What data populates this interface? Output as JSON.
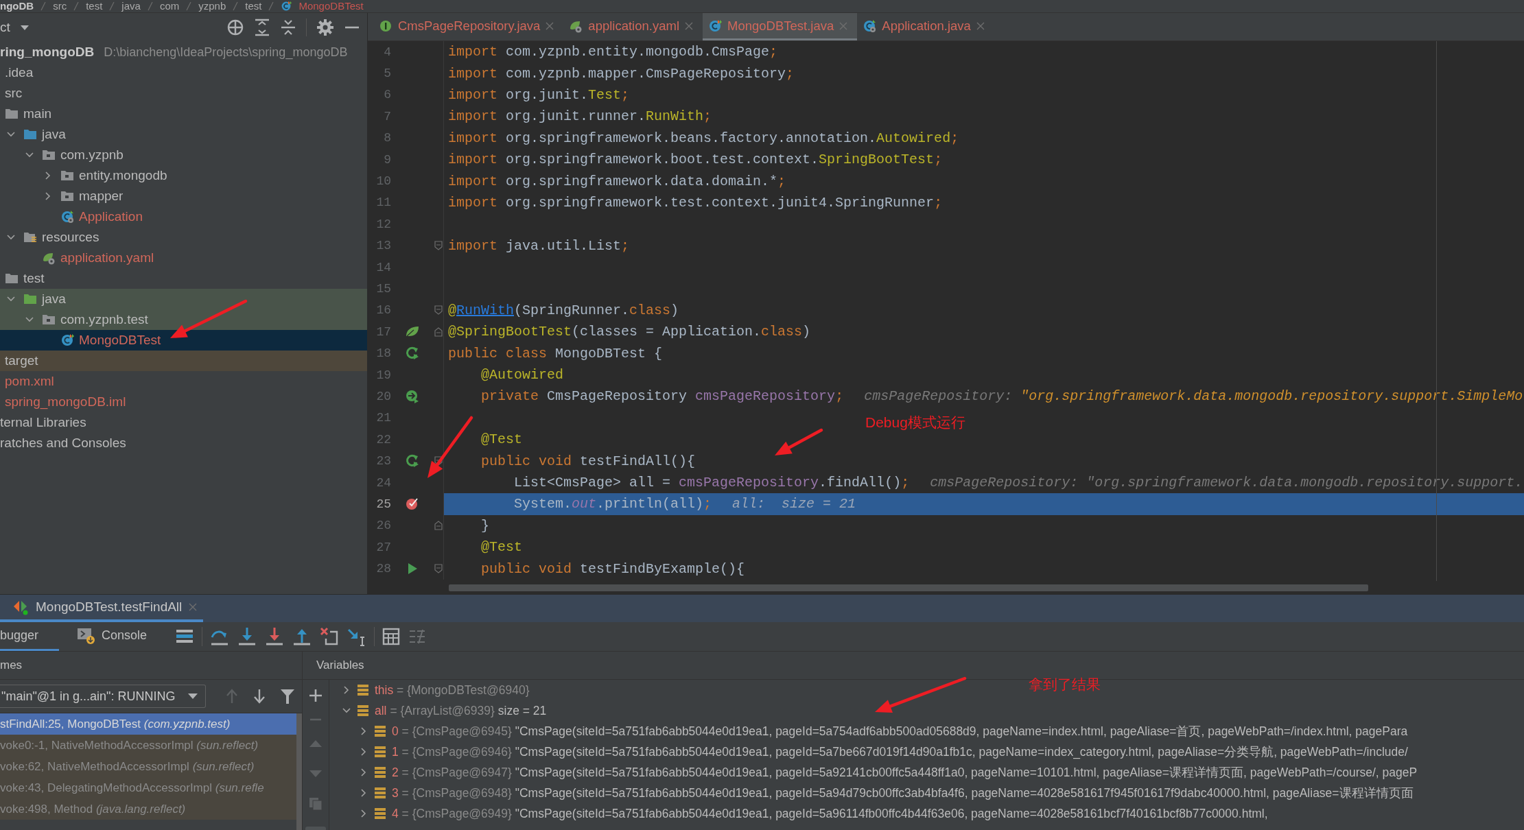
{
  "breadcrumb": [
    {
      "label": "ngoDB",
      "kind": "module"
    },
    {
      "label": "src"
    },
    {
      "label": "test"
    },
    {
      "label": "java"
    },
    {
      "label": "com"
    },
    {
      "label": "yzpnb"
    },
    {
      "label": "test"
    },
    {
      "label": "MongoDBTest",
      "kind": "class"
    }
  ],
  "project_panel": {
    "title": "ct",
    "tree": [
      {
        "label": "ring_mongoDB",
        "kind": "module",
        "path": "D:\\biancheng\\IdeaProjects\\spring_mongoDB",
        "untracked": false,
        "selected": false,
        "children": [
          {
            "label": ".idea",
            "untracked": false,
            "selected": false
          },
          {
            "label": "src",
            "untracked": false,
            "selected": false,
            "children": [
              {
                "label": "main",
                "kind": "folder",
                "untracked": false,
                "selected": false,
                "children": [
                  {
                    "label": "java",
                    "kind": "source_root",
                    "expanded": true,
                    "untracked": false,
                    "selected": false,
                    "children": [
                      {
                        "label": "com.yzpnb",
                        "kind": "package",
                        "expanded": true,
                        "untracked": false,
                        "selected": false,
                        "children": [
                          {
                            "label": "entity.mongodb",
                            "kind": "package",
                            "expanded": false,
                            "untracked": false,
                            "selected": false
                          },
                          {
                            "label": "mapper",
                            "kind": "package",
                            "expanded": false,
                            "untracked": false,
                            "selected": false
                          },
                          {
                            "label": "Application",
                            "kind": "boot_class",
                            "untracked": true,
                            "selected": false
                          }
                        ]
                      }
                    ]
                  },
                  {
                    "label": "resources",
                    "kind": "resources_root",
                    "expanded": true,
                    "untracked": false,
                    "selected": false,
                    "children": [
                      {
                        "label": "application.yaml",
                        "kind": "yaml",
                        "untracked": true,
                        "selected": false
                      }
                    ]
                  }
                ]
              },
              {
                "label": "test",
                "kind": "folder",
                "untracked": false,
                "selected": false,
                "children": [
                  {
                    "label": "java",
                    "kind": "test_root",
                    "expanded": true,
                    "test_scope": true,
                    "untracked": false,
                    "selected": false,
                    "children": [
                      {
                        "label": "com.yzpnb.test",
                        "kind": "package",
                        "expanded": true,
                        "test_scope": true,
                        "untracked": false,
                        "selected": false,
                        "children": [
                          {
                            "label": "MongoDBTest",
                            "kind": "test_class",
                            "untracked": true,
                            "selected": true
                          }
                        ]
                      }
                    ]
                  }
                ]
              }
            ]
          },
          {
            "label": "target",
            "excluded": true,
            "untracked": false,
            "selected": false
          },
          {
            "label": "pom.xml",
            "untracked": true,
            "selected": false
          },
          {
            "label": "spring_mongoDB.iml",
            "untracked": true,
            "selected": false
          }
        ]
      },
      {
        "label": "ternal Libraries",
        "untracked": false,
        "selected": false
      },
      {
        "label": "ratches and Consoles",
        "untracked": false,
        "selected": false
      }
    ]
  },
  "editor": {
    "tabs": [
      {
        "label": "CmsPageRepository.java",
        "kind": "interface",
        "selected": false
      },
      {
        "label": "application.yaml",
        "kind": "yaml",
        "selected": false
      },
      {
        "label": "MongoDBTest.java",
        "kind": "test_class",
        "selected": true
      },
      {
        "label": "Application.java",
        "kind": "boot_class",
        "selected": false
      }
    ],
    "lines": [
      {
        "number": "4",
        "current": false,
        "tokens": [
          {
            "text": "import",
            "kind": "keyword"
          },
          {
            "text": " com.yzpnb.entity.mongodb.CmsPage",
            "kind": "plain"
          },
          {
            "text": ";",
            "kind": "keyword"
          }
        ]
      },
      {
        "number": "5",
        "current": false,
        "tokens": [
          {
            "text": "import",
            "kind": "keyword"
          },
          {
            "text": " com.yzpnb.mapper.CmsPageRepository",
            "kind": "plain"
          },
          {
            "text": ";",
            "kind": "keyword"
          }
        ]
      },
      {
        "number": "6",
        "current": false,
        "tokens": [
          {
            "text": "import",
            "kind": "keyword"
          },
          {
            "text": " org.junit.",
            "kind": "plain"
          },
          {
            "text": "Test",
            "kind": "annotation"
          },
          {
            "text": ";",
            "kind": "keyword"
          }
        ]
      },
      {
        "number": "7",
        "current": false,
        "tokens": [
          {
            "text": "import",
            "kind": "keyword"
          },
          {
            "text": " org.junit.runner.",
            "kind": "plain"
          },
          {
            "text": "RunWith",
            "kind": "annotation"
          },
          {
            "text": ";",
            "kind": "keyword"
          }
        ]
      },
      {
        "number": "8",
        "current": false,
        "tokens": [
          {
            "text": "import",
            "kind": "keyword"
          },
          {
            "text": " org.springframework.beans.factory.annotation.",
            "kind": "plain"
          },
          {
            "text": "Autowired",
            "kind": "annotation"
          },
          {
            "text": ";",
            "kind": "keyword"
          }
        ]
      },
      {
        "number": "9",
        "current": false,
        "tokens": [
          {
            "text": "import",
            "kind": "keyword"
          },
          {
            "text": " org.springframework.boot.test.context.",
            "kind": "plain"
          },
          {
            "text": "SpringBootTest",
            "kind": "annotation"
          },
          {
            "text": ";",
            "kind": "keyword"
          }
        ]
      },
      {
        "number": "10",
        "current": false,
        "tokens": [
          {
            "text": "import",
            "kind": "keyword"
          },
          {
            "text": " org.springframework.data.domain.*",
            "kind": "plain"
          },
          {
            "text": ";",
            "kind": "keyword"
          }
        ]
      },
      {
        "number": "11",
        "current": false,
        "tokens": [
          {
            "text": "import",
            "kind": "keyword"
          },
          {
            "text": " org.springframework.test.context.junit4.SpringRunner",
            "kind": "plain"
          },
          {
            "text": ";",
            "kind": "keyword"
          }
        ]
      },
      {
        "number": "12",
        "current": false
      },
      {
        "number": "13",
        "current": false,
        "gutter": [
          {
            "kind": "fold_start"
          }
        ],
        "tokens": [
          {
            "text": "import",
            "kind": "keyword"
          },
          {
            "text": " java.util.List",
            "kind": "plain"
          },
          {
            "text": ";",
            "kind": "keyword"
          }
        ]
      },
      {
        "number": "14",
        "current": false
      },
      {
        "number": "15",
        "current": false
      },
      {
        "number": "16",
        "current": false,
        "gutter": [
          {
            "kind": "fold_start"
          }
        ],
        "tokens": [
          {
            "text": "@",
            "kind": "annotation"
          },
          {
            "text": "RunWith",
            "kind": "link"
          },
          {
            "text": "(SpringRunner.",
            "kind": "plain"
          },
          {
            "text": "class",
            "kind": "keyword"
          },
          {
            "text": ")",
            "kind": "plain"
          }
        ]
      },
      {
        "number": "17",
        "current": false,
        "gutter": [
          {
            "kind": "leaf"
          },
          {
            "kind": "fold_end"
          }
        ],
        "tokens": [
          {
            "text": "@SpringBootTest",
            "kind": "annotation"
          },
          {
            "text": "(classes = Application.",
            "kind": "plain"
          },
          {
            "text": "class",
            "kind": "keyword"
          },
          {
            "text": ")",
            "kind": "plain"
          }
        ]
      },
      {
        "number": "18",
        "current": false,
        "gutter": [
          {
            "kind": "rerun"
          }
        ],
        "tokens": [
          {
            "text": "public class",
            "kind": "keyword"
          },
          {
            "text": " MongoDBTest {",
            "kind": "plain"
          }
        ]
      },
      {
        "number": "19",
        "current": false,
        "tokens": [
          {
            "text": "    @Autowired",
            "kind": "annotation"
          }
        ]
      },
      {
        "number": "20",
        "current": false,
        "gutter": [
          {
            "kind": "bean"
          }
        ],
        "tokens": [
          {
            "text": "    private",
            "kind": "keyword"
          },
          {
            "text": " CmsPageRepository ",
            "kind": "plain"
          },
          {
            "text": "cmsPageRepository",
            "kind": "field"
          },
          {
            "text": ";",
            "kind": "keyword"
          }
        ],
        "hint": [
          {
            "text": "cmsPageRepository: ",
            "kind": "hint"
          },
          {
            "text": "\"org.springframework.data.mongodb.repository.support.SimpleMo",
            "kind": "hint_value"
          }
        ]
      },
      {
        "number": "21",
        "current": false
      },
      {
        "number": "22",
        "current": false,
        "tokens": [
          {
            "text": "    @Test",
            "kind": "annotation"
          }
        ]
      },
      {
        "number": "23",
        "current": false,
        "gutter": [
          {
            "kind": "rerun"
          },
          {
            "kind": "fold_start"
          }
        ],
        "tokens": [
          {
            "text": "    public void",
            "kind": "keyword"
          },
          {
            "text": " testFindAll(){",
            "kind": "plain"
          }
        ]
      },
      {
        "number": "24",
        "current": false,
        "tokens": [
          {
            "text": "        List<CmsPage> all = ",
            "kind": "plain"
          },
          {
            "text": "cmsPageRepository",
            "kind": "field"
          },
          {
            "text": ".findAll()",
            "kind": "plain"
          },
          {
            "text": ";",
            "kind": "keyword"
          }
        ],
        "hint": [
          {
            "text": "cmsPageRepository: \"org.springframework.data.mongodb.repository.support.",
            "kind": "hint"
          }
        ]
      },
      {
        "number": "25",
        "current": true,
        "gutter": [
          {
            "kind": "breakpoint"
          }
        ],
        "tokens": [
          {
            "text": "        System.",
            "kind": "plain"
          },
          {
            "text": "out",
            "kind": "static"
          },
          {
            "text": ".println(all)",
            "kind": "plain"
          },
          {
            "text": ";",
            "kind": "keyword"
          }
        ],
        "hint": [
          {
            "text": "all:  size = 21",
            "kind": "hint"
          }
        ]
      },
      {
        "number": "26",
        "current": false,
        "gutter": [
          {
            "kind": "fold_end"
          }
        ],
        "tokens": [
          {
            "text": "    }",
            "kind": "plain"
          }
        ]
      },
      {
        "number": "27",
        "current": false,
        "tokens": [
          {
            "text": "    @Test",
            "kind": "annotation"
          }
        ]
      },
      {
        "number": "28",
        "current": false,
        "gutter": [
          {
            "kind": "play"
          },
          {
            "kind": "fold_start"
          }
        ],
        "tokens": [
          {
            "text": "    public void",
            "kind": "keyword"
          },
          {
            "text": " testFindByExample(){",
            "kind": "plain"
          }
        ]
      }
    ]
  },
  "debug": {
    "session_tab": "MongoDBTest.testFindAll",
    "tabs": [
      {
        "label": "bugger",
        "kind": "debugger",
        "selected": true
      },
      {
        "label": "Console",
        "kind": "console",
        "selected": false
      }
    ],
    "frames_title": "mes",
    "thread": "\"main\"@1 in g...ain\": RUNNING",
    "frames": [
      {
        "label": "stFindAll:25, MongoDBTest *(com.yzpnb.test)*",
        "kind": "app",
        "selected": true
      },
      {
        "label": "voke0:-1, NativeMethodAccessorImpl *(sun.reflect)*",
        "kind": "library",
        "selected": false
      },
      {
        "label": "voke:62, NativeMethodAccessorImpl *(sun.reflect)*",
        "kind": "library",
        "selected": false
      },
      {
        "label": "voke:43, DelegatingMethodAccessorImpl *(sun.refle*",
        "kind": "library",
        "selected": false
      },
      {
        "label": "voke:498, Method *(java.lang.reflect)*",
        "kind": "library",
        "selected": false
      }
    ],
    "variables_title": "Variables",
    "variables": [
      {
        "name": "this",
        "type": "= {MongoDBTest@6940}",
        "expanded": false
      },
      {
        "name": "all",
        "type": "= {ArrayList@6939}",
        "value": "size = 21",
        "expanded": true,
        "children": [
          {
            "name": "0",
            "type": "= {CmsPage@6945}",
            "value": "\"CmsPage(siteId=5a751fab6abb5044e0d19ea1, pageId=5a754adf6abb500ad05688d9, pageName=index.html, pageAliase=首页, pageWebPath=/index.html, pagePara",
            "expanded": false
          },
          {
            "name": "1",
            "type": "= {CmsPage@6946}",
            "value": "\"CmsPage(siteId=5a751fab6abb5044e0d19ea1, pageId=5a7be667d019f14d90a1fb1c, pageName=index_category.html, pageAliase=分类导航, pageWebPath=/include/",
            "expanded": false
          },
          {
            "name": "2",
            "type": "= {CmsPage@6947}",
            "value": "\"CmsPage(siteId=5a751fab6abb5044e0d19ea1, pageId=5a92141cb00ffc5a448ff1a0, pageName=10101.html, pageAliase=课程详情页面, pageWebPath=/course/, pageP",
            "expanded": false
          },
          {
            "name": "3",
            "type": "= {CmsPage@6948}",
            "value": "\"CmsPage(siteId=5a751fab6abb5044e0d19ea1, pageId=5a94d79cb00ffc3ab4bfa4f6, pageName=4028e581617f945f01617f9dabc40000.html, pageAliase=课程详情页面",
            "expanded": false
          },
          {
            "name": "4",
            "type": "= {CmsPage@6949}",
            "value": "\"CmsPage(siteId=5a751fab6abb5044e0d19ea1, pageId=5a96114fb00ffc4b44f63e06, pageName=4028e58161bcf7f40161bcf8b77c0000.html,",
            "expanded": false
          }
        ]
      }
    ]
  },
  "annotations": [
    {
      "text": "Debug模式运行"
    },
    {
      "text": "拿到了结果"
    }
  ]
}
